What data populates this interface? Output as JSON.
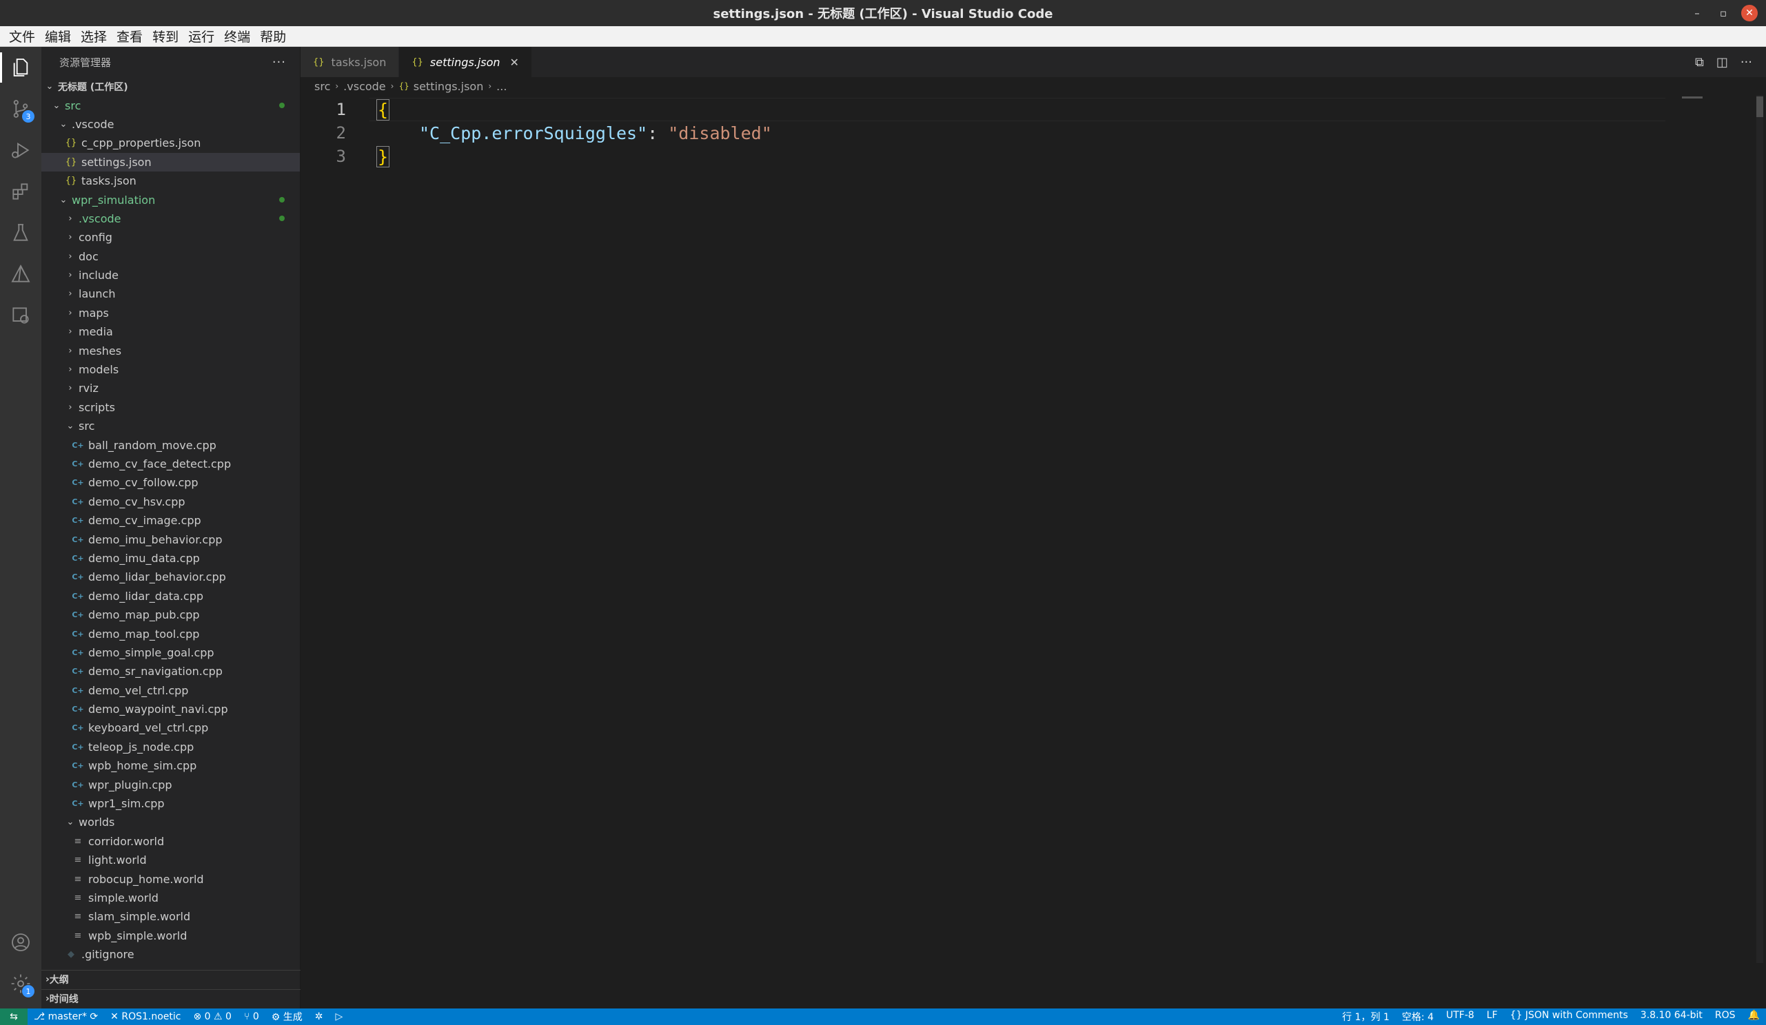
{
  "window": {
    "title": "settings.json - 无标题 (工作区) - Visual Studio Code"
  },
  "menu": [
    "文件",
    "编辑",
    "选择",
    "查看",
    "转到",
    "运行",
    "终端",
    "帮助"
  ],
  "activity": {
    "scm_badge": "3",
    "settings_badge": "1"
  },
  "sidebar": {
    "header": "资源管理器",
    "more": "···",
    "workspace": "无标题 (工作区)",
    "tree": [
      {
        "label": "src",
        "level": 1,
        "kind": "folder-open",
        "color": "green",
        "dot": true
      },
      {
        "label": ".vscode",
        "level": 2,
        "kind": "folder-open"
      },
      {
        "label": "c_cpp_properties.json",
        "level": 3,
        "kind": "json"
      },
      {
        "label": "settings.json",
        "level": 3,
        "kind": "json",
        "selected": true
      },
      {
        "label": "tasks.json",
        "level": 3,
        "kind": "json"
      },
      {
        "label": "wpr_simulation",
        "level": 2,
        "kind": "folder-open",
        "color": "green",
        "dot": true
      },
      {
        "label": ".vscode",
        "level": 3,
        "kind": "folder",
        "color": "green",
        "dot": true
      },
      {
        "label": "config",
        "level": 3,
        "kind": "folder"
      },
      {
        "label": "doc",
        "level": 3,
        "kind": "folder"
      },
      {
        "label": "include",
        "level": 3,
        "kind": "folder"
      },
      {
        "label": "launch",
        "level": 3,
        "kind": "folder"
      },
      {
        "label": "maps",
        "level": 3,
        "kind": "folder"
      },
      {
        "label": "media",
        "level": 3,
        "kind": "folder"
      },
      {
        "label": "meshes",
        "level": 3,
        "kind": "folder"
      },
      {
        "label": "models",
        "level": 3,
        "kind": "folder"
      },
      {
        "label": "rviz",
        "level": 3,
        "kind": "folder"
      },
      {
        "label": "scripts",
        "level": 3,
        "kind": "folder"
      },
      {
        "label": "src",
        "level": 3,
        "kind": "folder-open"
      },
      {
        "label": "ball_random_move.cpp",
        "level": 4,
        "kind": "cpp"
      },
      {
        "label": "demo_cv_face_detect.cpp",
        "level": 4,
        "kind": "cpp"
      },
      {
        "label": "demo_cv_follow.cpp",
        "level": 4,
        "kind": "cpp"
      },
      {
        "label": "demo_cv_hsv.cpp",
        "level": 4,
        "kind": "cpp"
      },
      {
        "label": "demo_cv_image.cpp",
        "level": 4,
        "kind": "cpp"
      },
      {
        "label": "demo_imu_behavior.cpp",
        "level": 4,
        "kind": "cpp"
      },
      {
        "label": "demo_imu_data.cpp",
        "level": 4,
        "kind": "cpp"
      },
      {
        "label": "demo_lidar_behavior.cpp",
        "level": 4,
        "kind": "cpp"
      },
      {
        "label": "demo_lidar_data.cpp",
        "level": 4,
        "kind": "cpp"
      },
      {
        "label": "demo_map_pub.cpp",
        "level": 4,
        "kind": "cpp"
      },
      {
        "label": "demo_map_tool.cpp",
        "level": 4,
        "kind": "cpp"
      },
      {
        "label": "demo_simple_goal.cpp",
        "level": 4,
        "kind": "cpp"
      },
      {
        "label": "demo_sr_navigation.cpp",
        "level": 4,
        "kind": "cpp"
      },
      {
        "label": "demo_vel_ctrl.cpp",
        "level": 4,
        "kind": "cpp"
      },
      {
        "label": "demo_waypoint_navi.cpp",
        "level": 4,
        "kind": "cpp"
      },
      {
        "label": "keyboard_vel_ctrl.cpp",
        "level": 4,
        "kind": "cpp"
      },
      {
        "label": "teleop_js_node.cpp",
        "level": 4,
        "kind": "cpp"
      },
      {
        "label": "wpb_home_sim.cpp",
        "level": 4,
        "kind": "cpp"
      },
      {
        "label": "wpr_plugin.cpp",
        "level": 4,
        "kind": "cpp"
      },
      {
        "label": "wpr1_sim.cpp",
        "level": 4,
        "kind": "cpp"
      },
      {
        "label": "worlds",
        "level": 3,
        "kind": "folder-open"
      },
      {
        "label": "corridor.world",
        "level": 4,
        "kind": "world"
      },
      {
        "label": "light.world",
        "level": 4,
        "kind": "world"
      },
      {
        "label": "robocup_home.world",
        "level": 4,
        "kind": "world"
      },
      {
        "label": "simple.world",
        "level": 4,
        "kind": "world"
      },
      {
        "label": "slam_simple.world",
        "level": 4,
        "kind": "world"
      },
      {
        "label": "wpb_simple.world",
        "level": 4,
        "kind": "world"
      },
      {
        "label": ".gitignore",
        "level": 3,
        "kind": "git"
      }
    ],
    "outline": "大纲",
    "timeline": "时间线"
  },
  "tabs": [
    {
      "label": "tasks.json",
      "active": false
    },
    {
      "label": "settings.json",
      "active": true
    }
  ],
  "breadcrumb": [
    "src",
    ".vscode",
    "settings.json",
    "..."
  ],
  "editor": {
    "lines": [
      "1",
      "2",
      "3"
    ],
    "open_brace": "{",
    "key": "\"C_Cpp.errorSquiggles\"",
    "colon": ": ",
    "value": "\"disabled\"",
    "close_brace": "}"
  },
  "status": {
    "branch": "master*",
    "ros": "ROS1.noetic",
    "errors": "0",
    "warnings": "0",
    "ports": "0",
    "build": "生成",
    "position": "行 1，列 1",
    "spaces": "空格: 4",
    "encoding": "UTF-8",
    "eol": "LF",
    "language": "JSON with Comments",
    "interpreter": "3.8.10 64-bit",
    "ros_right": "ROS"
  }
}
